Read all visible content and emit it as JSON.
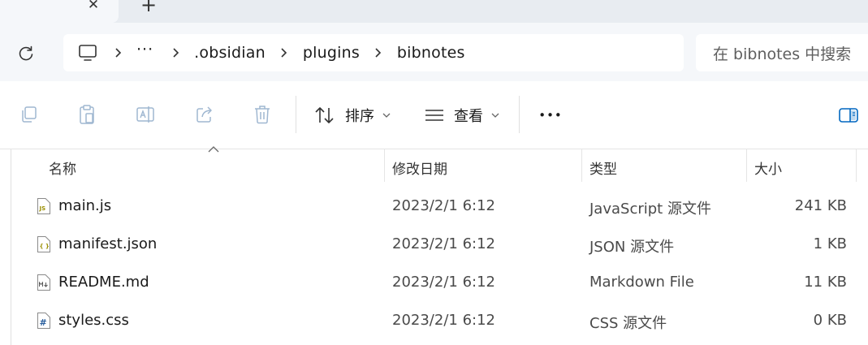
{
  "tabs": {
    "close_glyph": "✕",
    "new_glyph": "+"
  },
  "nav": {
    "refresh_icon": "refresh-icon",
    "breadcrumb": {
      "ellipsis": "···",
      "items": [
        ".obsidian",
        "plugins",
        "bibnotes"
      ]
    },
    "search_placeholder": "在 bibnotes 中搜索"
  },
  "toolbar": {
    "sort_label": "排序",
    "view_label": "查看",
    "more_glyph": "•••"
  },
  "columns": {
    "name": "名称",
    "modified": "修改日期",
    "type": "类型",
    "size": "大小"
  },
  "files": [
    {
      "name": "main.js",
      "modified": "2023/2/1 6:12",
      "type": "JavaScript 源文件",
      "size": "241 KB",
      "icon": "js-file-icon"
    },
    {
      "name": "manifest.json",
      "modified": "2023/2/1 6:12",
      "type": "JSON 源文件",
      "size": "1 KB",
      "icon": "json-file-icon"
    },
    {
      "name": "README.md",
      "modified": "2023/2/1 6:12",
      "type": "Markdown File",
      "size": "11 KB",
      "icon": "markdown-file-icon"
    },
    {
      "name": "styles.css",
      "modified": "2023/2/1 6:12",
      "type": "CSS 源文件",
      "size": "0 KB",
      "icon": "css-file-icon"
    }
  ],
  "colors": {
    "chrome_bg": "#f5f7fa",
    "tabstrip_bg": "#e8ecf1",
    "accent_blue": "#0067c0",
    "disabled_icon": "#9fb7d1"
  }
}
